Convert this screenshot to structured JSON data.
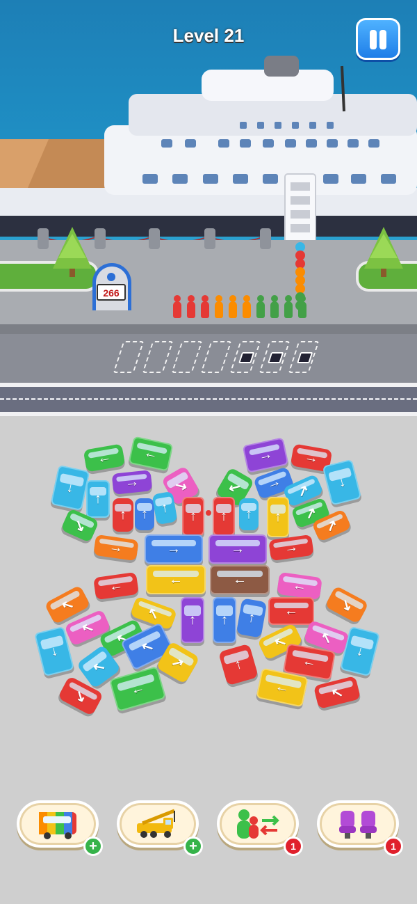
{
  "hud": {
    "level_label": "Level 21",
    "pause_icon": "pause-icon"
  },
  "dock": {
    "passenger_counter": "266",
    "queue_colors": [
      "#e53935",
      "#e53935",
      "#e53935",
      "#fb8c00",
      "#fb8c00",
      "#fb8c00",
      "#43a047",
      "#43a047",
      "#43a047",
      "#43a047"
    ],
    "parking_slots_total": 7,
    "parking_slots_with_seat": 3
  },
  "vehicles_arrow_colors": {
    "red": "#e53935",
    "blue": "#3f7fe6",
    "green": "#3cc04a",
    "purple": "#8e44d6",
    "yellow": "#f2c318",
    "cyan": "#38b7e6",
    "pink": "#ec5fc2",
    "orange": "#f57c1f",
    "brown": "#8d5a44"
  },
  "boosters": [
    {
      "name": "recolor-bus-booster",
      "icon": "rainbow-bus-icon",
      "badge": "+",
      "badge_color": "#36b34a"
    },
    {
      "name": "crane-booster",
      "icon": "crane-truck-icon",
      "badge": "+",
      "badge_color": "#36b34a"
    },
    {
      "name": "swap-passengers-booster",
      "icon": "swap-people-icon",
      "badge": "1",
      "badge_color": "#e0202c"
    },
    {
      "name": "extra-seat-booster",
      "icon": "seats-icon",
      "badge": "1",
      "badge_color": "#e0202c"
    }
  ]
}
